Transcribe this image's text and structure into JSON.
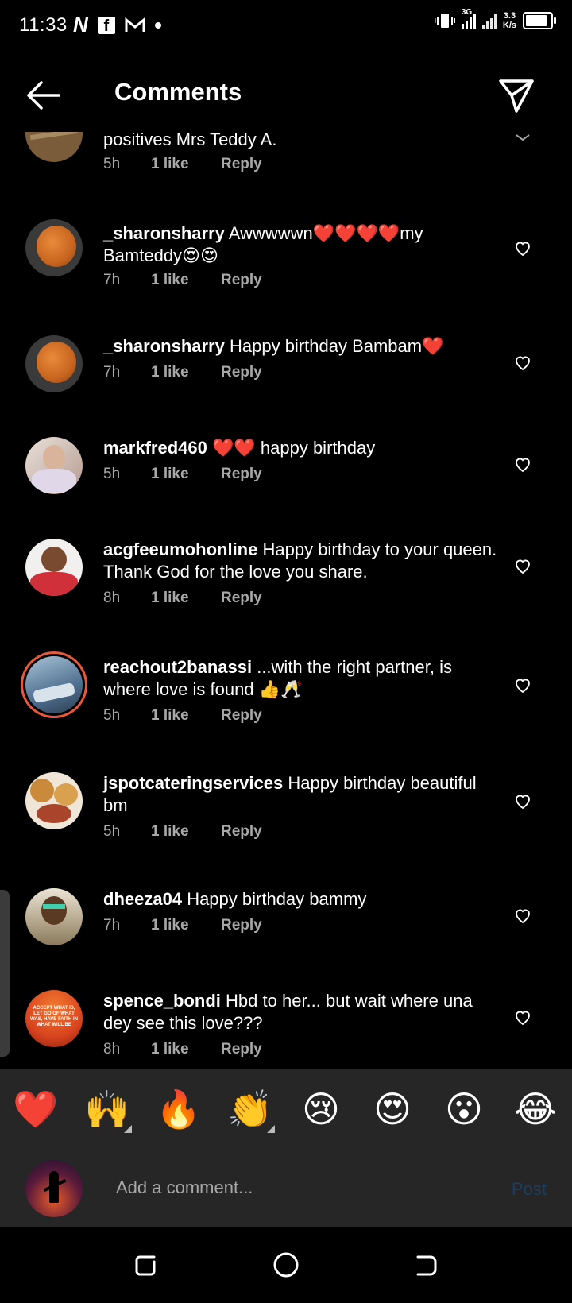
{
  "status_bar": {
    "time": "11:33",
    "icons": [
      "n-app-icon",
      "facebook-icon",
      "gmail-icon",
      "dot-icon"
    ],
    "network": "3G",
    "speed_value": "3.3",
    "speed_unit": "K/s"
  },
  "header": {
    "title": "Comments",
    "back_icon": "back-arrow-icon",
    "send_icon": "paper-plane-icon"
  },
  "comments": [
    {
      "user": "",
      "text": "positives Mrs Teddy A.",
      "time": "5h",
      "likes": "1 like",
      "reply": "Reply",
      "avatar_color": "#7a5c3a"
    },
    {
      "user": "_sharonsharry",
      "text": "Awwwwwn❤️❤️❤️❤️my Bamteddy😍😍",
      "time": "7h",
      "likes": "1 like",
      "reply": "Reply",
      "avatar_color": "#c8651f"
    },
    {
      "user": "_sharonsharry",
      "text": "Happy birthday Bambam❤️",
      "time": "7h",
      "likes": "1 like",
      "reply": "Reply",
      "avatar_color": "#c8651f"
    },
    {
      "user": "markfred460",
      "text": "❤️❤️ happy birthday",
      "time": "5h",
      "likes": "1 like",
      "reply": "Reply",
      "avatar_color": "#d8cfc8"
    },
    {
      "user": "acgfeeumohonline",
      "text": "Happy birthday to your queen. Thank God for the love you share.",
      "time": "8h",
      "likes": "1 like",
      "reply": "Reply",
      "avatar_color": "#d0303a"
    },
    {
      "user": "reachout2banassi",
      "text": "...with the right partner, is where love is found 👍🥂",
      "time": "5h",
      "likes": "1 like",
      "reply": "Reply",
      "avatar_color": "#6d8aa8"
    },
    {
      "user": "jspotcateringservices",
      "text": "Happy birthday beautiful bm",
      "time": "5h",
      "likes": "1 like",
      "reply": "Reply",
      "avatar_color": "#c98a3c"
    },
    {
      "user": "dheeza04",
      "text": "Happy birthday bammy",
      "time": "7h",
      "likes": "1 like",
      "reply": "Reply",
      "avatar_color": "#b8a88a"
    },
    {
      "user": "spence_bondi",
      "text": "Hbd to her... but wait where una dey see this love???",
      "time": "8h",
      "likes": "1 like",
      "reply": "Reply",
      "avatar_color": "#d9441e",
      "avatar_text": "ACCEPT WHAT IS, LET GO OF WHAT WAS, HAVE FAITH IN WHAT WILL BE"
    }
  ],
  "reactions": [
    "❤️",
    "🙌",
    "🔥",
    "👏",
    "😢",
    "😍",
    "😮",
    "😂"
  ],
  "compose": {
    "placeholder": "Add a comment...",
    "post_label": "Post"
  },
  "colors": {
    "background": "#000000",
    "meta_text": "#a8a8a8",
    "bottom_panel": "#262626",
    "post_disabled": "#1d3d60",
    "story_ring": "#e8583d"
  }
}
